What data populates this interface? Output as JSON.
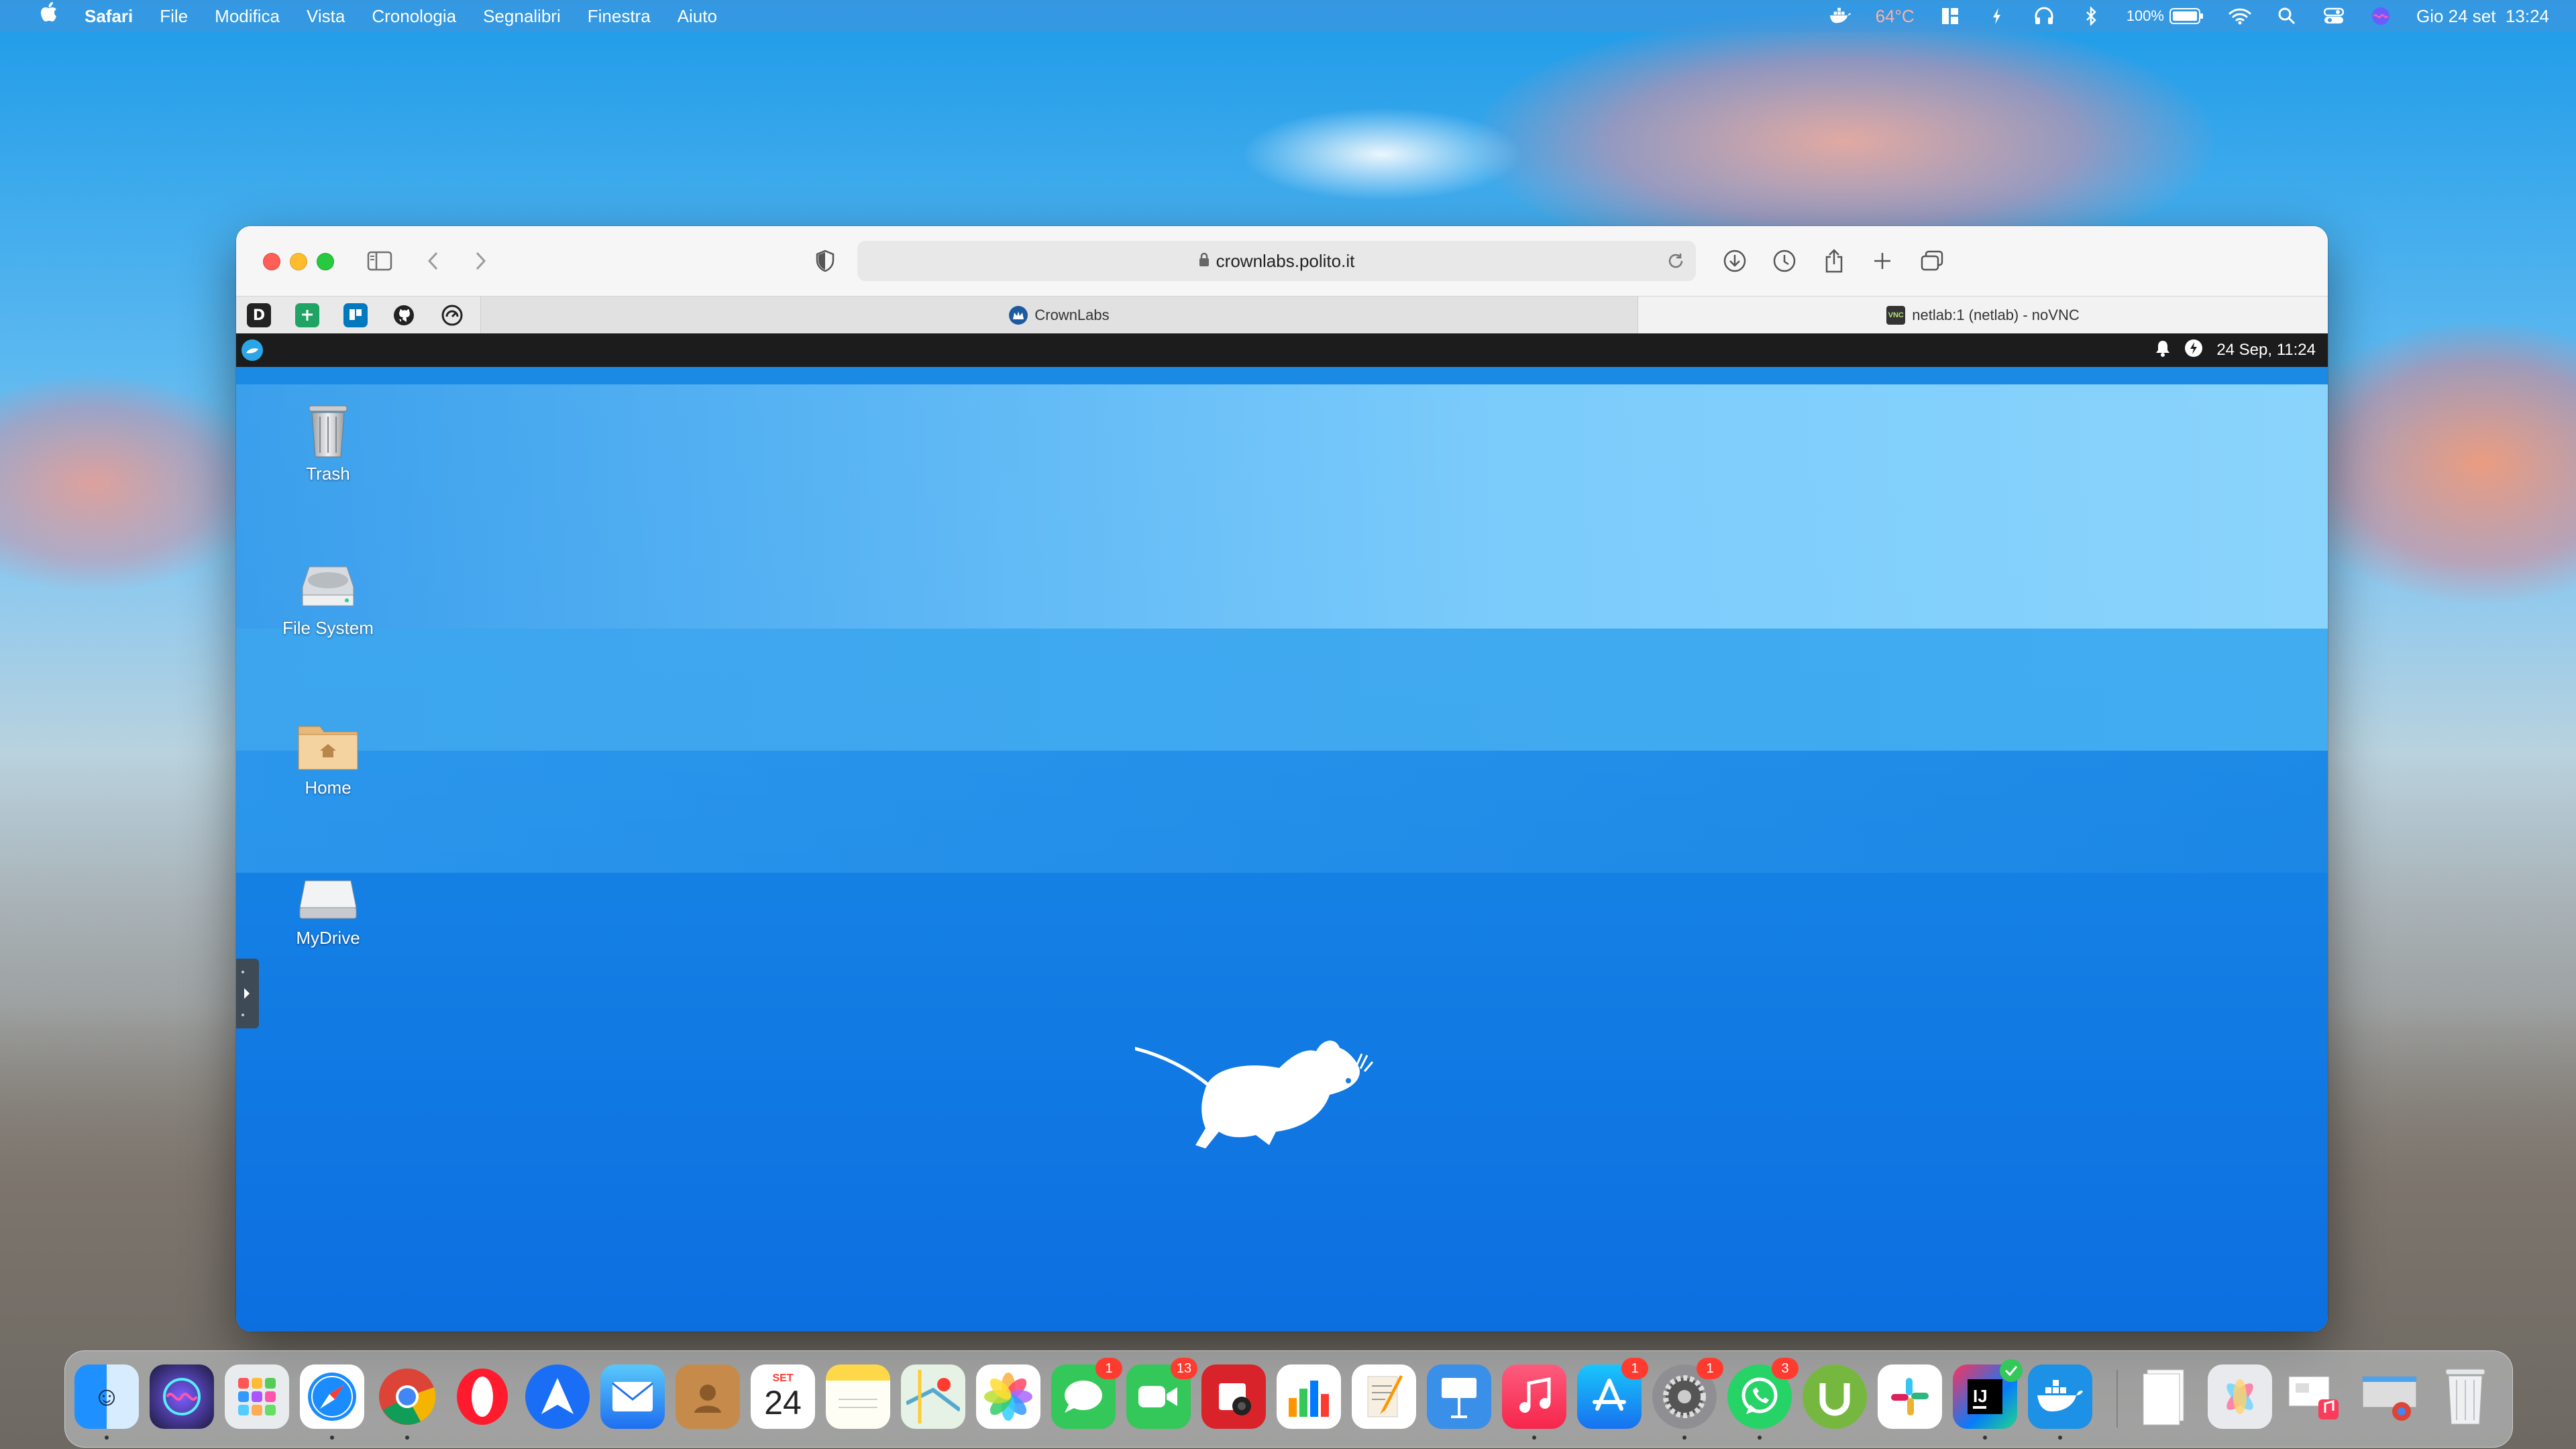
{
  "menubar": {
    "app_name": "Safari",
    "menus": [
      "File",
      "Modifica",
      "Vista",
      "Cronologia",
      "Segnalibri",
      "Finestra",
      "Aiuto"
    ],
    "temperature": "64°C",
    "battery": "100%",
    "datetime": "Gio 24 set  13:24"
  },
  "browser": {
    "url": "crownlabs.polito.it",
    "tabs": [
      {
        "title": "CrownLabs",
        "active": false
      },
      {
        "title": "netlab:1 (netlab) - noVNC",
        "active": true
      }
    ],
    "favorites": [
      "D",
      "sheets",
      "trello",
      "github",
      "speed"
    ]
  },
  "remote": {
    "panel_datetime": "24 Sep, 11:24",
    "desktop_icons": [
      {
        "label": "Trash"
      },
      {
        "label": "File System"
      },
      {
        "label": "Home"
      },
      {
        "label": "MyDrive"
      }
    ]
  },
  "dock": {
    "calendar_month": "SET",
    "calendar_day": "24",
    "badges": {
      "messages": "1",
      "facetime": "13",
      "appstore": "1",
      "settings": "1",
      "whatsapp": "3"
    }
  }
}
